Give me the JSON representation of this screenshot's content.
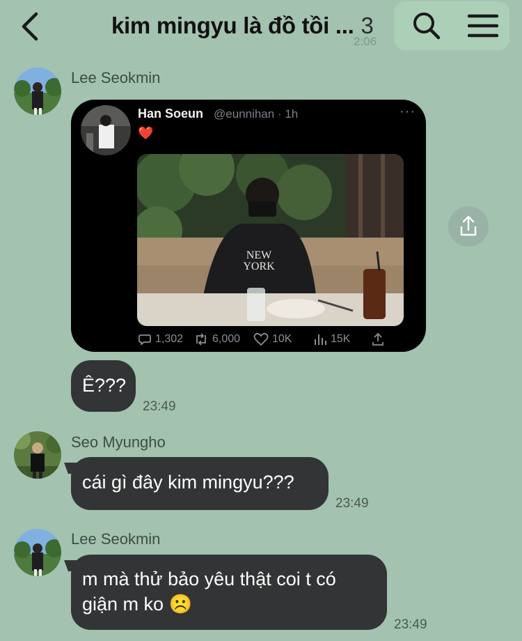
{
  "header": {
    "title": "kim mingyu là đồ tồi ...",
    "member_count": "3",
    "faded_time": "2:06"
  },
  "messages": [
    {
      "sender": "Lee Seokmin",
      "tweet": {
        "name": "Han Soeun",
        "handle": "@eunnihan · 1h",
        "heart": "❤️",
        "more": "···",
        "stats": {
          "replies": "1,302",
          "retweets": "6,000",
          "likes": "10K",
          "views": "15K"
        }
      },
      "text": "Ê???",
      "time": "23:49"
    },
    {
      "sender": "Seo Myungho",
      "text": "cái gì đây kim mingyu???",
      "time": "23:49"
    },
    {
      "sender": "Lee Seokmin",
      "text_line1": "m mà thử bảo yêu thật coi t có",
      "text_line2": "giận m ko ☹️",
      "time": "23:49"
    }
  ],
  "icons": {
    "back": "chevron-left-icon",
    "search": "search-icon",
    "menu": "menu-icon",
    "share": "share-icon"
  },
  "colors": {
    "background": "#a3c2b0",
    "bubble": "#333435",
    "tweet_bg": "#000000"
  }
}
